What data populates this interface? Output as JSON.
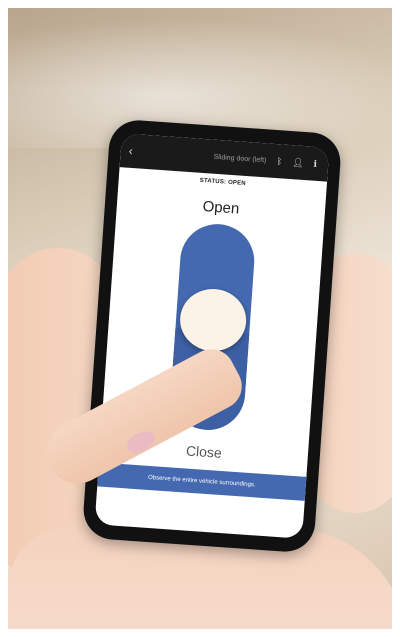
{
  "app": {
    "title": "Sliding door (left)",
    "status_text": "STATUS: OPEN"
  },
  "topbar": {
    "back_icon": "chevron-left-icon",
    "icons": [
      "bluetooth-icon",
      "person-icon",
      "info-icon"
    ]
  },
  "slider": {
    "top_label": "Open",
    "bottom_label": "Close",
    "position": 0.45
  },
  "notice": {
    "text": "Observe the entire vehicle surroundings."
  },
  "colors": {
    "accent": "#4469b0",
    "knob": "#fbf3e6"
  }
}
